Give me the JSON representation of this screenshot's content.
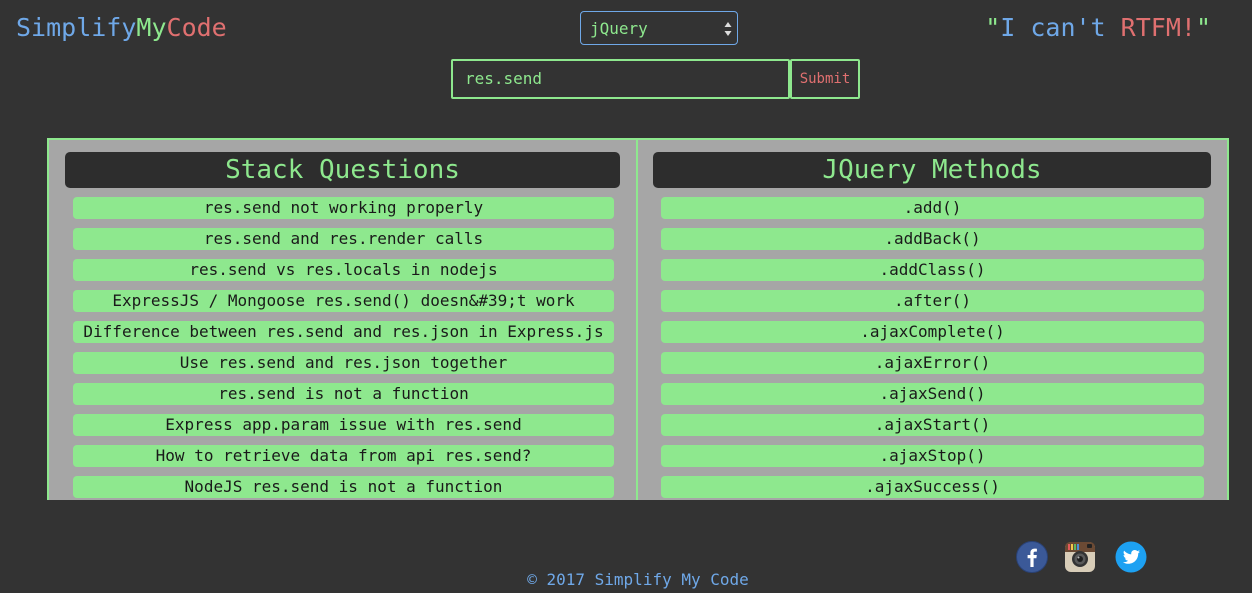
{
  "header": {
    "logo": {
      "part1": "Simplify",
      "part2": "My",
      "part3": "Code"
    },
    "library_select": {
      "value": "jQuery"
    },
    "tagline": {
      "open_quote": "\"",
      "part1": "I can't",
      "part2": "RTFM!",
      "close_quote": "\""
    },
    "search": {
      "value": "res.send",
      "submit_label": "Submit"
    }
  },
  "results": {
    "left": {
      "title": "Stack Questions",
      "items": [
        "res.send not working properly",
        "res.send and res.render calls",
        "res.send vs res.locals in nodejs",
        "ExpressJS / Mongoose res.send() doesn&#39;t work",
        "Difference between res.send and res.json in Express.js",
        "Use res.send and res.json together",
        "res.send is not a function",
        "Express app.param issue with res.send",
        "How to retrieve data from api res.send?",
        "NodeJS res.send is not a function"
      ]
    },
    "right": {
      "title": "JQuery Methods",
      "items": [
        ".add()",
        ".addBack()",
        ".addClass()",
        ".after()",
        ".ajaxComplete()",
        ".ajaxError()",
        ".ajaxSend()",
        ".ajaxStart()",
        ".ajaxStop()",
        ".ajaxSuccess()"
      ]
    }
  },
  "footer": {
    "copyright": "© 2017 Simplify My Code",
    "social": [
      "facebook-icon",
      "instagram-icon",
      "twitter-icon"
    ]
  },
  "colors": {
    "background": "#333333",
    "green": "#8ee88e",
    "blue": "#6fa8e8",
    "red": "#e07070",
    "panel": "#a6a6a6"
  }
}
